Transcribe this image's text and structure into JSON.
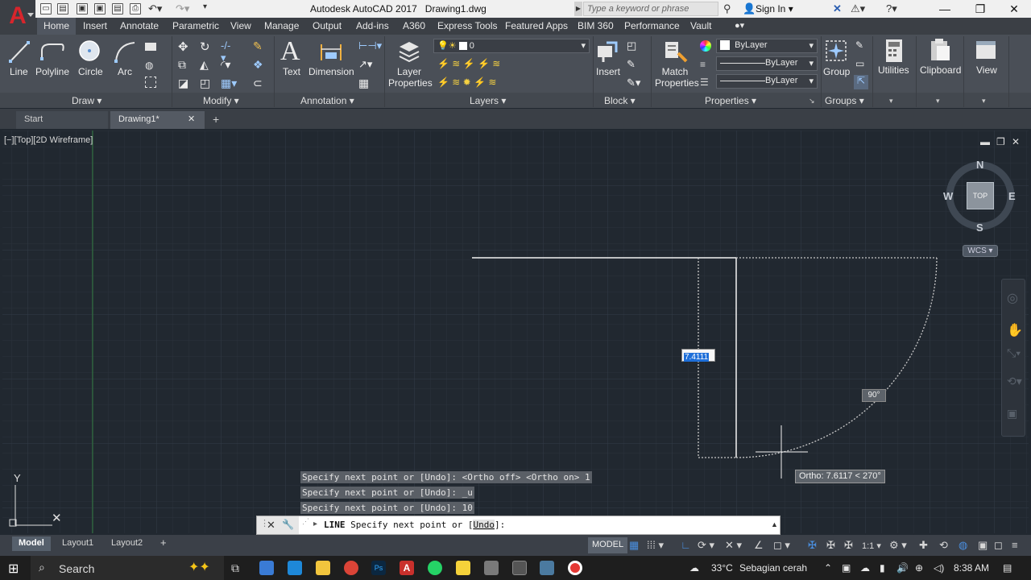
{
  "title": {
    "app": "Autodesk AutoCAD 2017",
    "file": "Drawing1.dwg"
  },
  "search": {
    "placeholder": "Type a keyword or phrase"
  },
  "account": {
    "signin": "Sign In"
  },
  "ribbon_tabs": [
    "Home",
    "Insert",
    "Annotate",
    "Parametric",
    "View",
    "Manage",
    "Output",
    "Add-ins",
    "A360",
    "Express Tools",
    "Featured Apps",
    "BIM 360",
    "Performance",
    "Vault"
  ],
  "draw_panel": {
    "title": "Draw",
    "tools": [
      "Line",
      "Polyline",
      "Circle",
      "Arc"
    ]
  },
  "modify_panel": {
    "title": "Modify"
  },
  "annotation_panel": {
    "title": "Annotation",
    "tools": [
      "Text",
      "Dimension"
    ]
  },
  "layers_panel": {
    "title": "Layers",
    "tool1": "Layer",
    "tool2": "Properties",
    "current_layer": "0"
  },
  "block_panel": {
    "title": "Block",
    "tool": "Insert"
  },
  "properties_panel": {
    "title": "Properties",
    "match1": "Match",
    "match2": "Properties",
    "color": "ByLayer",
    "linetype": "ByLayer",
    "lineweight": "ByLayer"
  },
  "groups_panel": {
    "title": "Groups",
    "tool": "Group"
  },
  "utilities": {
    "label": "Utilities"
  },
  "clipboard": {
    "label": "Clipboard"
  },
  "view": {
    "label": "View"
  },
  "file_tabs": {
    "start": "Start",
    "drawing": "Drawing1*"
  },
  "viewport": {
    "label": "[−][Top][2D Wireframe]"
  },
  "viewcube": {
    "n": "N",
    "s": "S",
    "e": "E",
    "w": "W",
    "face": "TOP",
    "wcs": "WCS"
  },
  "dynamic_input": {
    "length": "7.4111",
    "angle": "90°",
    "ortho_tooltip": "Ortho: 7.6117 < 270°"
  },
  "ucs": {
    "y": "Y"
  },
  "command_history": [
    "Specify next point or [Undo]:  <Ortho off>  <Ortho on> 1",
    "Specify next point or [Undo]: _u",
    "Specify next point or [Undo]: 10"
  ],
  "command_line": {
    "command": "LINE",
    "prompt": "Specify next point or [",
    "option": "Undo",
    "end": "]:"
  },
  "layout_tabs": [
    "Model",
    "Layout1",
    "Layout2"
  ],
  "status": {
    "model": "MODEL",
    "scale": "1:1"
  },
  "taskbar": {
    "search": "Search",
    "temp": "33°C",
    "weather": "Sebagian cerah",
    "time": "8:38 AM"
  },
  "colors": {
    "accent": "#0078d7",
    "autocad_red": "#d7252c",
    "selection_blue": "#1e6fd9"
  }
}
